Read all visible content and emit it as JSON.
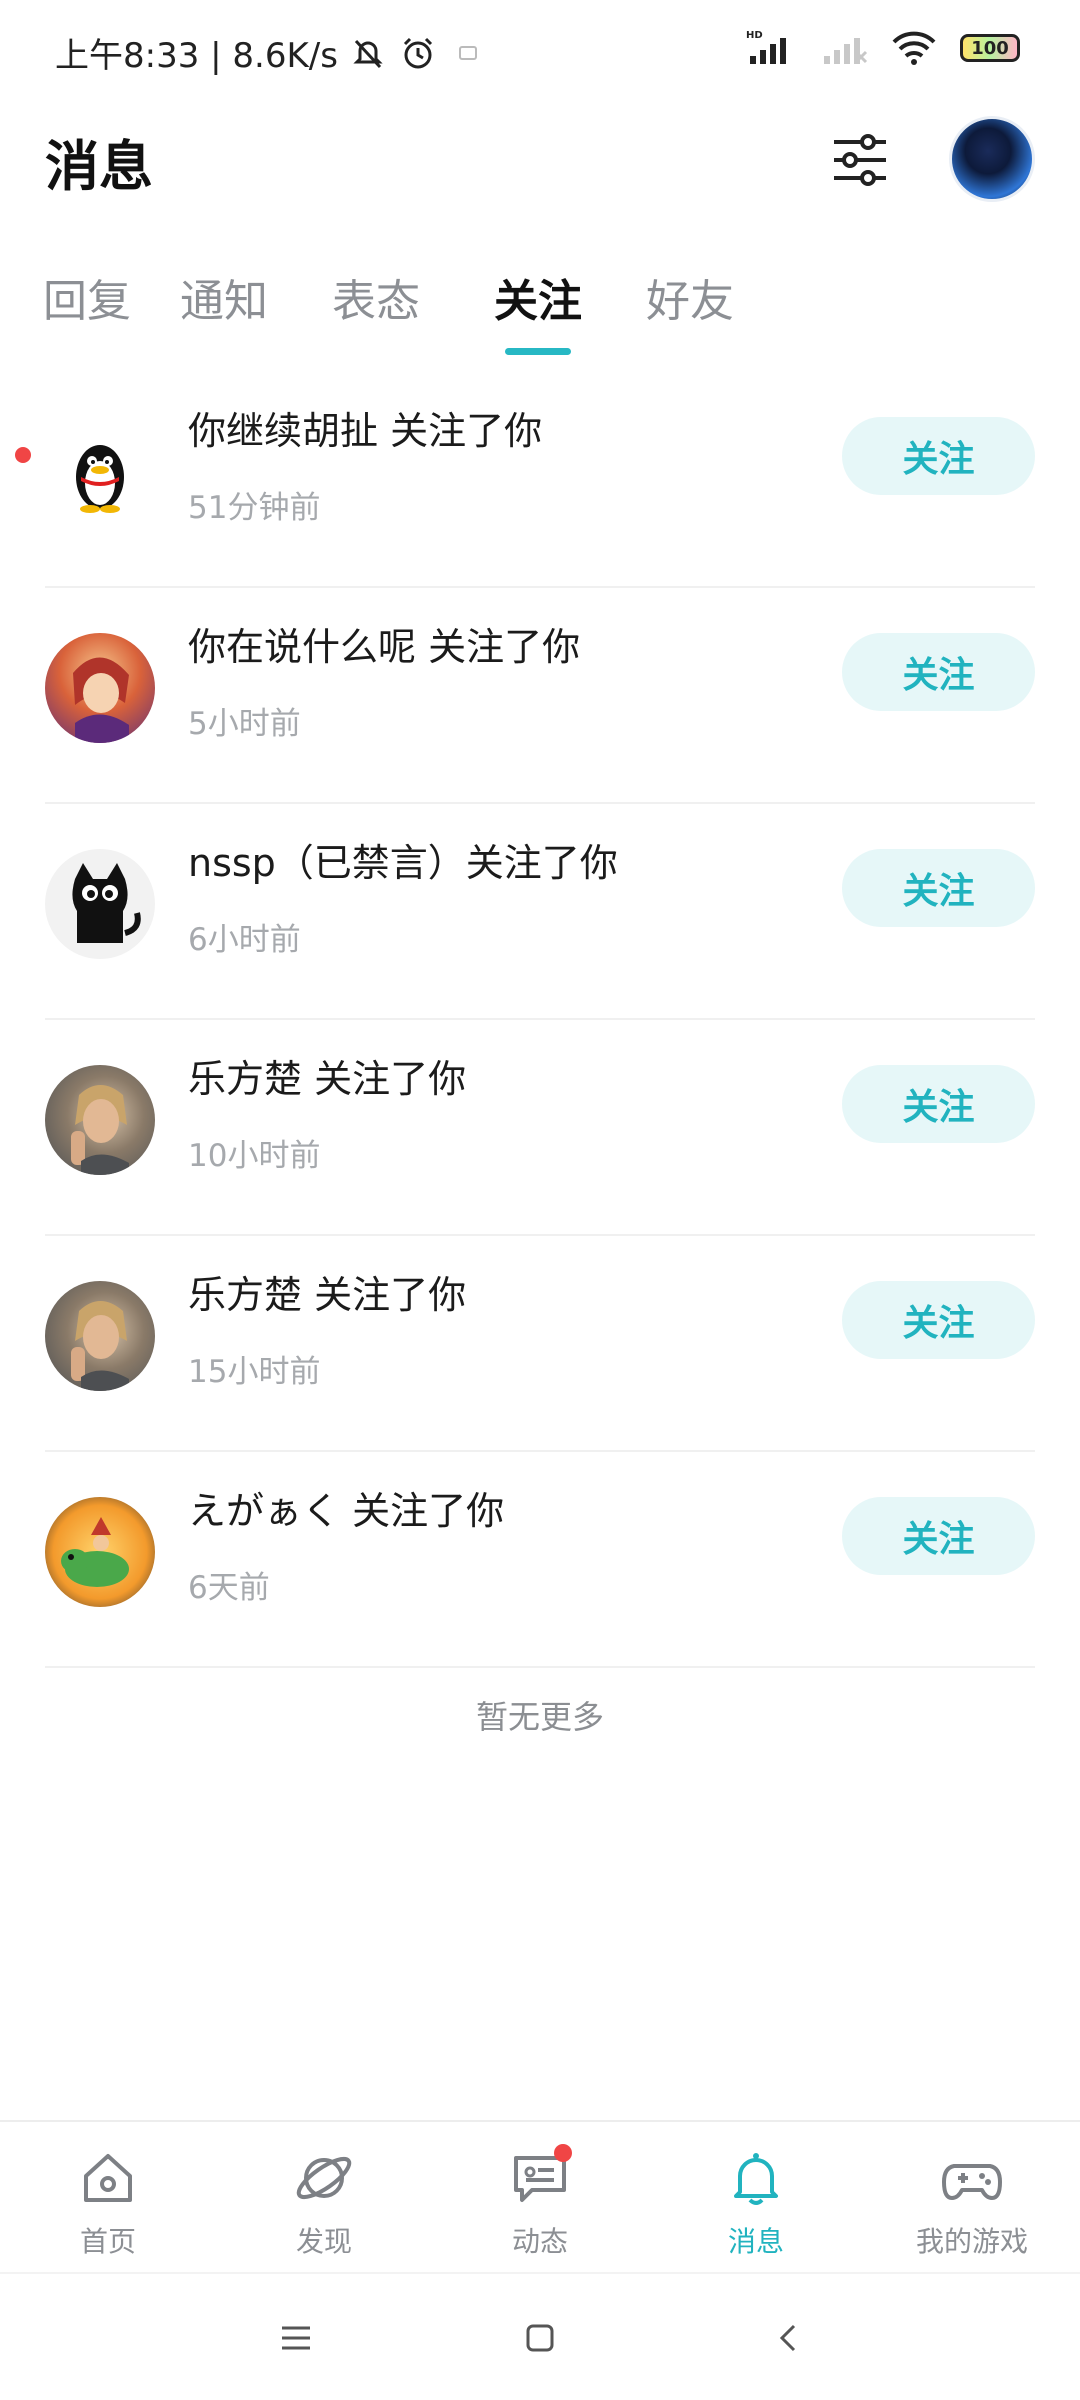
{
  "status_bar": {
    "time_speed": "上午8:33 | 8.6K/s",
    "battery": "100",
    "network_label": "HD"
  },
  "header": {
    "title": "消息"
  },
  "tabs": [
    {
      "label": "回复",
      "active": false
    },
    {
      "label": "通知",
      "active": false
    },
    {
      "label": "表态",
      "active": false
    },
    {
      "label": "关注",
      "active": true
    },
    {
      "label": "好友",
      "active": false
    }
  ],
  "follows": [
    {
      "text": "你继续胡扯 关注了你",
      "time": "51分钟前",
      "button": "关注",
      "unread": true,
      "avatar": "qq-penguin-avatar"
    },
    {
      "text": "你在说什么呢 关注了你",
      "time": "5小时前",
      "button": "关注",
      "unread": false,
      "avatar": "anime-avatar"
    },
    {
      "text": "nssp（已禁言）关注了你",
      "time": "6小时前",
      "button": "关注",
      "unread": false,
      "avatar": "black-cat-avatar"
    },
    {
      "text": "乐方楚 关注了你",
      "time": "10小时前",
      "button": "关注",
      "unread": false,
      "avatar": "man-avatar"
    },
    {
      "text": "乐方楚 关注了你",
      "time": "15小时前",
      "button": "关注",
      "unread": false,
      "avatar": "man-avatar"
    },
    {
      "text": "えがぁく 关注了你",
      "time": "6天前",
      "button": "关注",
      "unread": false,
      "avatar": "dinosaur-avatar"
    }
  ],
  "footer_note": "暂无更多",
  "bottom_nav": [
    {
      "label": "首页",
      "icon": "home-icon",
      "active": false
    },
    {
      "label": "发现",
      "icon": "planet-icon",
      "active": false
    },
    {
      "label": "动态",
      "icon": "chat-icon",
      "active": false,
      "badge": true
    },
    {
      "label": "消息",
      "icon": "bell-icon",
      "active": true
    },
    {
      "label": "我的游戏",
      "icon": "gamepad-icon",
      "active": false
    }
  ],
  "colors": {
    "accent": "#21b3bf",
    "button_bg": "#e6f7f8",
    "badge": "#f04545"
  }
}
